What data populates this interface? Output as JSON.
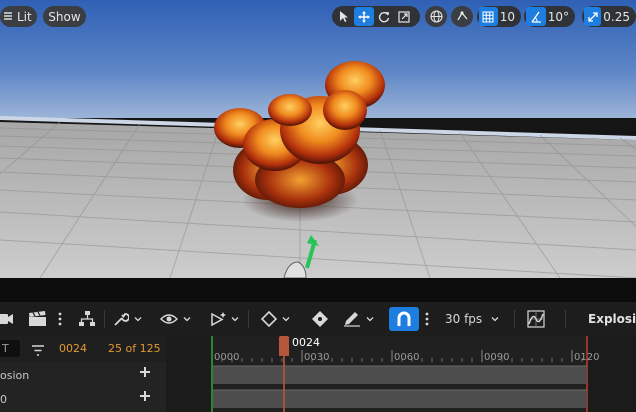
{
  "viewport": {
    "lit_label": "Lit",
    "show_label": "Show",
    "grid_snap_value": "10",
    "rotation_snap_value": "10°",
    "scale_snap_value": "0.25"
  },
  "toolbar": {
    "fps_label": "30 fps",
    "asset_name": "Explosion"
  },
  "sequencer": {
    "search_text": "T",
    "current_frame": "0024",
    "frame_count_label": "25 of 125",
    "playhead_label": "0024",
    "ruler_labels": [
      "0000",
      "0030",
      "0060",
      "0090",
      "0120"
    ],
    "tracks": [
      {
        "label": "osion"
      },
      {
        "label": "0"
      }
    ]
  },
  "colors": {
    "accent": "#1d7ee0",
    "frame_text": "#e29a2e",
    "playhead": "#b5553c"
  }
}
